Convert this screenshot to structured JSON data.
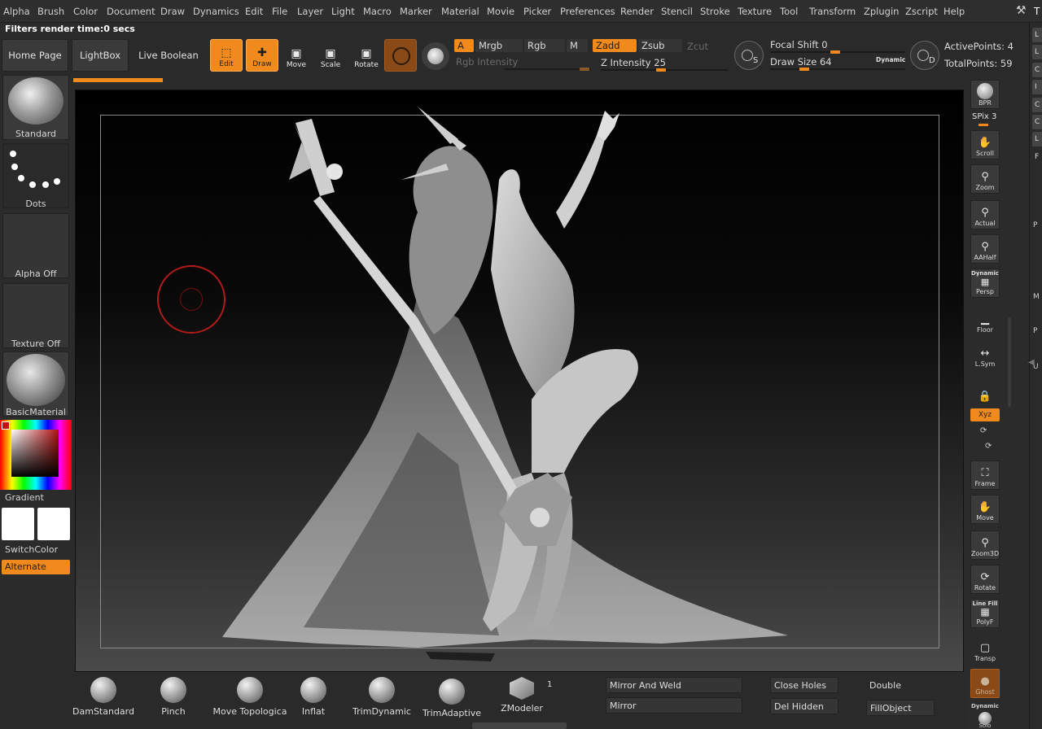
{
  "menu": {
    "items": [
      "Alpha",
      "Brush",
      "Color",
      "Document",
      "Draw",
      "Dynamics",
      "Edit",
      "File",
      "Layer",
      "Light",
      "Macro",
      "Marker",
      "Material",
      "Movie",
      "Picker",
      "Preferences",
      "Render",
      "Stencil",
      "Stroke",
      "Texture",
      "Tool",
      "Transform",
      "Zplugin",
      "Zscript",
      "Help"
    ],
    "right_tab": "T"
  },
  "status": "Filters render time:0 secs",
  "toolbar": {
    "home_page": "Home Page",
    "lightbox": "LightBox",
    "live_boolean": "Live Boolean",
    "edit": "Edit",
    "draw": "Draw",
    "move": "Move",
    "scale": "Scale",
    "rotate": "Rotate",
    "a": "A",
    "mrgb": "Mrgb",
    "rgb": "Rgb",
    "m": "M",
    "zadd": "Zadd",
    "zsub": "Zsub",
    "zcut": "Zcut",
    "rgb_intensity": "Rgb Intensity",
    "z_intensity_label": "Z Intensity",
    "z_intensity_value": "25",
    "focal_shift_label": "Focal Shift",
    "focal_shift_value": "0",
    "draw_size_label": "Draw Size",
    "draw_size_value": "64",
    "dynamic": "Dynamic",
    "active_points": "ActivePoints: 4",
    "total_points": "TotalPoints: 59"
  },
  "left_shelf": {
    "standard": "Standard",
    "dots": "Dots",
    "alpha_off": "Alpha Off",
    "texture_off": "Texture Off",
    "basic_material": "BasicMaterial",
    "gradient": "Gradient",
    "switch_color": "SwitchColor",
    "alternate": "Alternate"
  },
  "right_shelf": {
    "bpr": "BPR",
    "spix_label": "SPix",
    "spix_value": "3",
    "scroll": "Scroll",
    "zoom": "Zoom",
    "actual": "Actual",
    "aahalf": "AAHalf",
    "dynamic": "Dynamic",
    "persp": "Persp",
    "floor": "Floor",
    "lsym": "L.Sym",
    "xyz": "Xyz",
    "frame": "Frame",
    "move": "Move",
    "zoom3d": "Zoom3D",
    "rotate": "Rotate",
    "line_fill": "Line Fill",
    "polyf": "PolyF",
    "transp": "Transp",
    "ghost": "Ghost",
    "dynamic_bottom": "Dynamic",
    "solo": "Solo"
  },
  "tray_tabs": [
    "L",
    "L",
    "C",
    "I",
    "C",
    "C",
    "L",
    "F"
  ],
  "tray_side": [
    "P",
    "M",
    "P",
    "U"
  ],
  "bottom_shelf": {
    "brushes": [
      "DamStandard",
      "Pinch",
      "Move Topologica",
      "Inflat",
      "TrimDynamic",
      "TrimAdaptive",
      "ZModeler"
    ],
    "zmodeler_badge": "1",
    "mirror_and_weld": "Mirror And Weld",
    "mirror": "Mirror",
    "close_holes": "Close Holes",
    "del_hidden": "Del Hidden",
    "double": "Double",
    "fill_object": "FillObject"
  }
}
